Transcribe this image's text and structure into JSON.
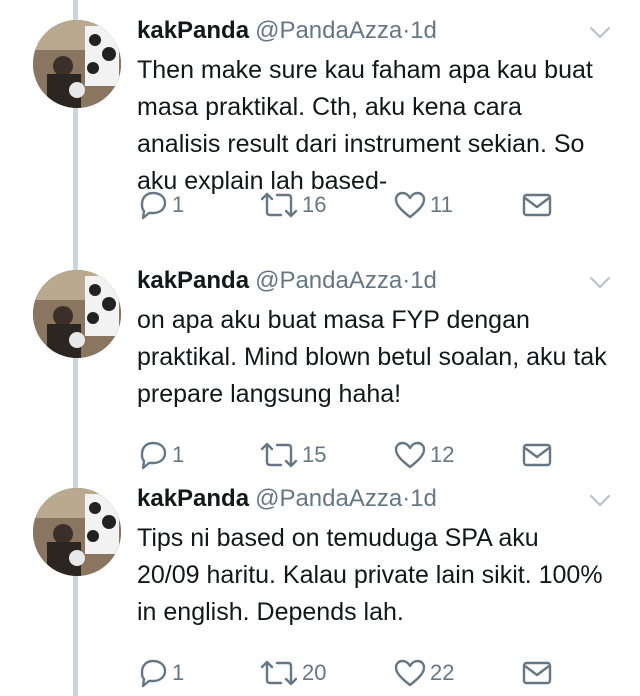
{
  "colors": {
    "text": "#14171a",
    "muted": "#657786",
    "thread_line": "#c9d4dc",
    "background": "#ffffff"
  },
  "tweets": [
    {
      "name": "kakPanda",
      "handle": "@PandaAzza",
      "separator": "·",
      "time": "1d",
      "text": "Then make sure kau faham apa kau buat masa praktikal. Cth, aku kena cara analisis result dari instrument sekian. So aku explain lah based-",
      "replies": "1",
      "retweets": "16",
      "likes": "11",
      "icons": [
        "reply-icon",
        "retweet-icon",
        "heart-icon",
        "envelope-icon",
        "chevron-down-icon"
      ]
    },
    {
      "name": "kakPanda",
      "handle": "@PandaAzza",
      "separator": "·",
      "time": "1d",
      "text": "on apa aku buat masa FYP dengan praktikal. Mind blown betul soalan, aku tak prepare langsung haha!",
      "replies": "1",
      "retweets": "15",
      "likes": "12",
      "icons": [
        "reply-icon",
        "retweet-icon",
        "heart-icon",
        "envelope-icon",
        "chevron-down-icon"
      ]
    },
    {
      "name": "kakPanda",
      "handle": "@PandaAzza",
      "separator": "·",
      "time": "1d",
      "text": "Tips ni based on temuduga SPA aku 20/09 haritu. Kalau private lain sikit. 100% in english. Depends lah.",
      "replies": "1",
      "retweets": "20",
      "likes": "22",
      "icons": [
        "reply-icon",
        "retweet-icon",
        "heart-icon",
        "envelope-icon",
        "chevron-down-icon"
      ]
    }
  ]
}
